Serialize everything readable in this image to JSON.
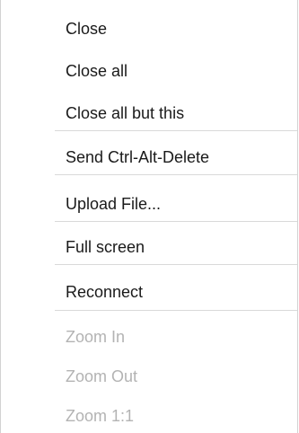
{
  "menu": {
    "items": [
      {
        "label": "Close"
      },
      {
        "label": "Close all"
      },
      {
        "label": "Close all but this"
      },
      {
        "label": "Send Ctrl-Alt-Delete"
      },
      {
        "label": "Upload File..."
      },
      {
        "label": "Full screen"
      },
      {
        "label": "Reconnect"
      },
      {
        "label": "Zoom In"
      },
      {
        "label": "Zoom Out"
      },
      {
        "label": "Zoom 1:1"
      }
    ]
  }
}
